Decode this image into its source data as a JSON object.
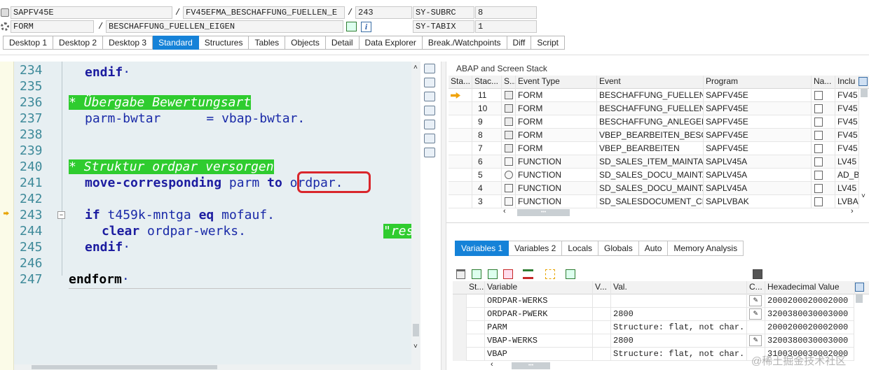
{
  "header": {
    "program": "SAPFV45E",
    "include": "FV45EFMA_BESCHAFFUNG_FUELLEN_E",
    "line": "243",
    "sy_subrc_label": "SY-SUBRC",
    "sy_subrc_value": "8",
    "event_type": "FORM",
    "event_name": "BESCHAFFUNG_FUELLEN_EIGEN",
    "sy_tabix_label": "SY-TABIX",
    "sy_tabix_value": "1",
    "slash": "/",
    "info_icon": "i"
  },
  "tabs": [
    "Desktop 1",
    "Desktop 2",
    "Desktop 3",
    "Standard",
    "Structures",
    "Tables",
    "Objects",
    "Detail",
    "Data Explorer",
    "Break./Watchpoints",
    "Diff",
    "Script"
  ],
  "active_tab": "Standard",
  "editor": {
    "line_numbers": [
      "234",
      "235",
      "236",
      "237",
      "238",
      "239",
      "240",
      "241",
      "242",
      "243",
      "244",
      "245",
      "246",
      "247"
    ],
    "code": {
      "l234": "endif",
      "l236": "* Übergabe Bewertungsart",
      "l237": "parm-bwtar      = vbap-bwtar.",
      "l240": "* Struktur ordpar versorgen",
      "l241_kw": "move-corresponding",
      "l241_a": " parm ",
      "l241_to": "to",
      "l241_b": "ordpar.",
      "l243_if": "if",
      "l243_a": " t459k-mntga ",
      "l243_eq": "eq",
      "l243_b": " mofauf.",
      "l244_kw": "clear",
      "l244_a": " ordpar-werks.",
      "l244_cmt": "\"res",
      "l245": "endif",
      "l247": "endform",
      "dot": "·"
    }
  },
  "stack": {
    "title": "ABAP and Screen Stack",
    "columns": [
      "Sta...",
      "Stac...",
      "S...",
      "Event Type",
      "Event",
      "Program",
      "Na...",
      "Inclu"
    ],
    "rows": [
      {
        "level": "11",
        "type": "FORM",
        "event": "BESCHAFFUNG_FUELLEN_E",
        "program": "SAPFV45E",
        "include": "FV45",
        "current": true
      },
      {
        "level": "10",
        "type": "FORM",
        "event": "BESCHAFFUNG_FUELLEN",
        "program": "SAPFV45E",
        "include": "FV45"
      },
      {
        "level": "9",
        "type": "FORM",
        "event": "BESCHAFFUNG_ANLEGEN",
        "program": "SAPFV45E",
        "include": "FV45"
      },
      {
        "level": "8",
        "type": "FORM",
        "event": "VBEP_BEARBEITEN_BESCH",
        "program": "SAPFV45E",
        "include": "FV45"
      },
      {
        "level": "7",
        "type": "FORM",
        "event": "VBEP_BEARBEITEN",
        "program": "SAPFV45E",
        "include": "FV45"
      },
      {
        "level": "6",
        "type": "FUNCTION",
        "event": "SD_SALES_ITEM_MAINTAI",
        "program": "SAPLV45A",
        "include": "LV45"
      },
      {
        "level": "5",
        "type": "FUNCTION",
        "event": "SD_SALES_DOCU_MAINTA",
        "program": "SAPLV45A",
        "include": "AD_B"
      },
      {
        "level": "4",
        "type": "FUNCTION",
        "event": "SD_SALES_DOCU_MAINTA",
        "program": "SAPLV45A",
        "include": "LV45"
      },
      {
        "level": "3",
        "type": "FUNCTION",
        "event": "SD_SALESDOCUMENT_CRE",
        "program": "SAPLVBAK",
        "include": "LVBA"
      }
    ]
  },
  "var_tabs": [
    "Variables 1",
    "Variables 2",
    "Locals",
    "Globals",
    "Auto",
    "Memory Analysis"
  ],
  "variables": {
    "columns": [
      "St...",
      "Variable",
      "V...",
      "Val.",
      "C...",
      "Hexadecimal Value"
    ],
    "rows": [
      {
        "name": "ORDPAR-WERKS",
        "value": "",
        "hex": "2000200020002000",
        "pen": true
      },
      {
        "name": "ORDPAR-PWERK",
        "value": "2800",
        "hex": "3200380030003000",
        "pen": true
      },
      {
        "name": "PARM",
        "value": "Structure: flat, not char.",
        "hex": "2000200020002000",
        "pen": false
      },
      {
        "name": "VBAP-WERKS",
        "value": "2800",
        "hex": "3200380030003000",
        "pen": true
      },
      {
        "name": "VBAP",
        "value": "Structure: flat, not char.",
        "hex": "3100300030002000",
        "pen": false
      }
    ]
  },
  "watermark": "@稀土掘金技术社区",
  "scroll_grip": "•••"
}
